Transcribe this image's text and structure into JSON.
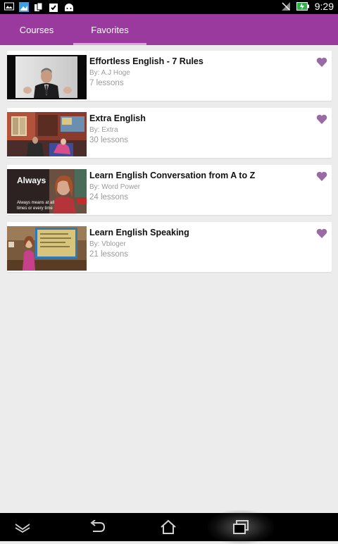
{
  "status": {
    "time": "9:29"
  },
  "tabs": [
    {
      "label": "Courses",
      "selected": false
    },
    {
      "label": "Favorites",
      "selected": true
    }
  ],
  "accent_color": "#9b3a9e",
  "heart_color": "#9a6aa4",
  "courses": [
    {
      "title": "Effortless English - 7 Rules",
      "author": "By: A.J Hoge",
      "lessons": "7 lessons"
    },
    {
      "title": "Extra English",
      "author": "By: Extra",
      "lessons": "30 lessons"
    },
    {
      "title": "Learn English Conversation from A to Z",
      "author": "By: Word Power",
      "lessons": "24 lessons",
      "thumb_text": "Always",
      "thumb_caption": "Always means at all times or every time"
    },
    {
      "title": "Learn English Speaking",
      "author": "By: Vbloger",
      "lessons": "21 lessons"
    }
  ]
}
